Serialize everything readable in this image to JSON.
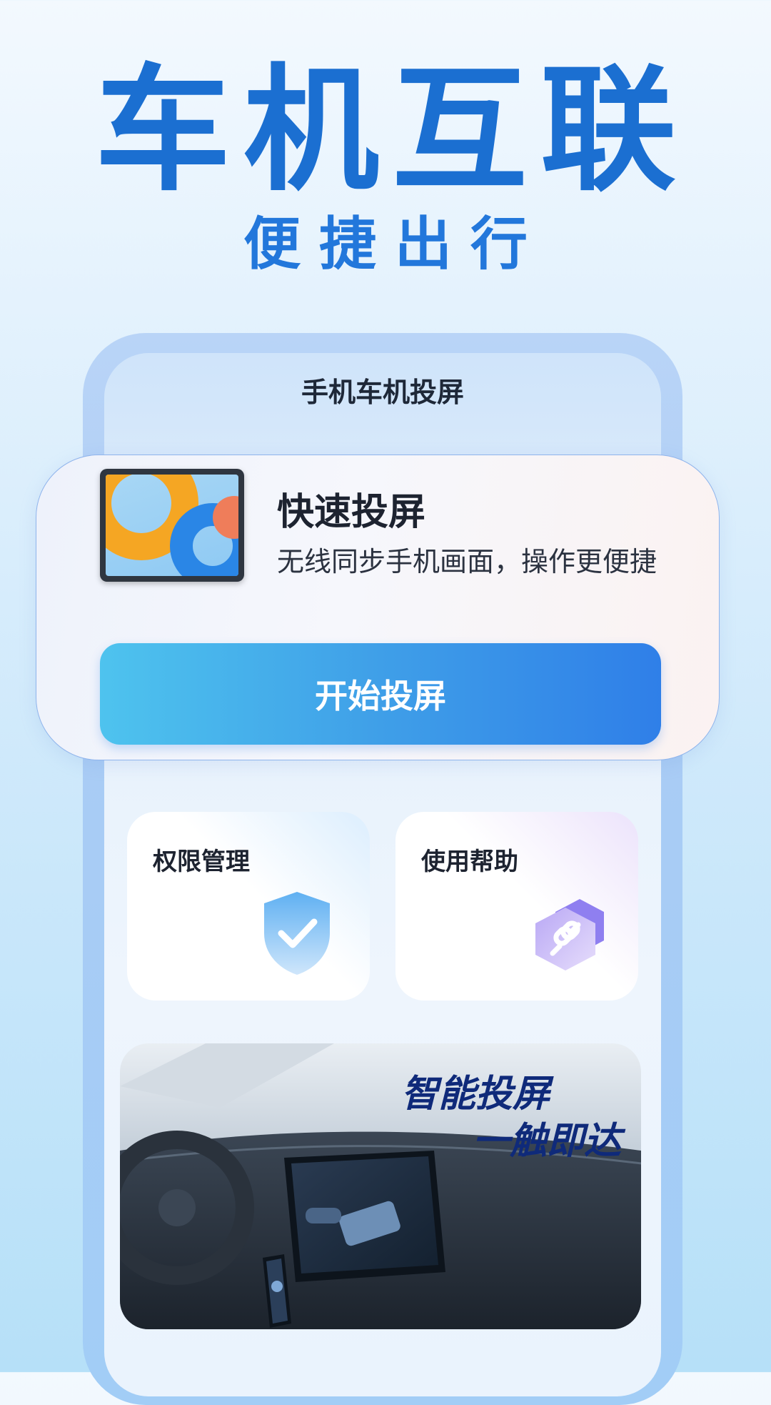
{
  "hero": {
    "title": "车机互联",
    "subtitle": "便捷出行"
  },
  "screen": {
    "title": "手机车机投屏"
  },
  "quick_cast": {
    "title": "快速投屏",
    "description": "无线同步手机画面，操作更便捷",
    "button_label": "开始投屏",
    "icon": "tablet-icon"
  },
  "tiles": [
    {
      "label": "权限管理",
      "icon": "shield-check-icon"
    },
    {
      "label": "使用帮助",
      "icon": "link-icon"
    }
  ],
  "banner": {
    "line1": "智能投屏",
    "line2": "一触即达"
  },
  "colors": {
    "brand_blue": "#1b6fd1",
    "button_start": "#4ec3ee",
    "button_end": "#2f7fe8",
    "banner_text": "#0f2a7a"
  }
}
